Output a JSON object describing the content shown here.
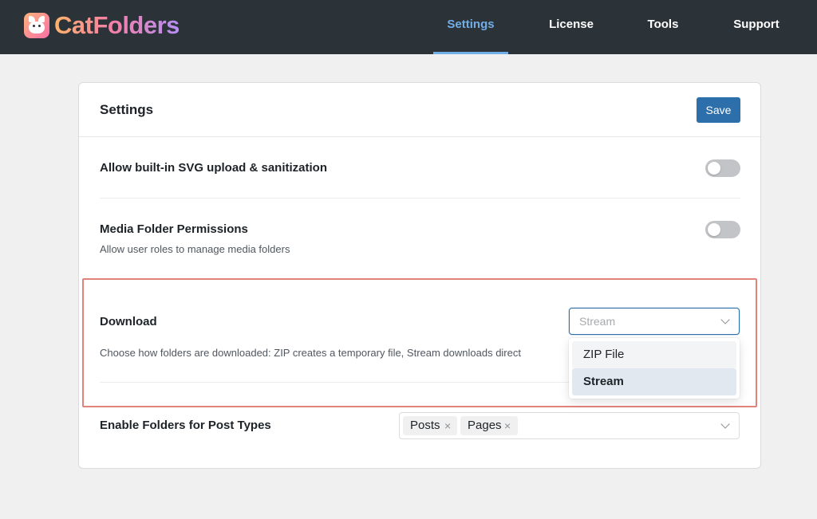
{
  "app": {
    "name": "CatFolders",
    "logo_icon": "cat-face-icon",
    "accent_color": "#72aee6",
    "primary_button_color": "#2d6fab",
    "highlight_color": "#e0837b"
  },
  "nav": {
    "items": [
      {
        "label": "Settings",
        "active": true
      },
      {
        "label": "License",
        "active": false
      },
      {
        "label": "Tools",
        "active": false
      },
      {
        "label": "Support",
        "active": false
      }
    ]
  },
  "card": {
    "title": "Settings",
    "save_label": "Save"
  },
  "settings": {
    "svg_upload": {
      "label": "Allow built-in SVG upload & sanitization",
      "enabled": false
    },
    "media_permissions": {
      "label": "Media Folder Permissions",
      "description": "Allow user roles to manage media folders",
      "enabled": false
    },
    "download": {
      "label": "Download",
      "description": "Choose how folders are downloaded: ZIP creates a temporary file, Stream downloads direct",
      "placeholder": "Stream",
      "options": [
        {
          "label": "ZIP File",
          "state": "hover"
        },
        {
          "label": "Stream",
          "state": "selected"
        }
      ]
    },
    "post_types": {
      "label": "Enable Folders for Post Types",
      "tags": [
        "Posts",
        "Pages"
      ],
      "remove_symbol": "×"
    }
  }
}
